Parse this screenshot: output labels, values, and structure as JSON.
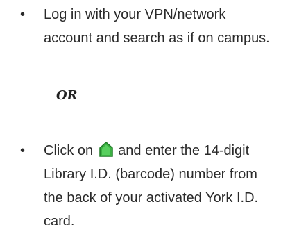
{
  "list": {
    "bullet_symbol": "•",
    "item1": {
      "text": "Log in with your VPN/network account and search as if on campus."
    },
    "separator": "OR",
    "item2": {
      "before_icon": "Click on",
      "icon": "home-icon",
      "icon_color": "#3cb043",
      "after_icon": "and enter the 14-digit Library I.D. (barcode) number from the back of your activated York I.D. card."
    }
  }
}
